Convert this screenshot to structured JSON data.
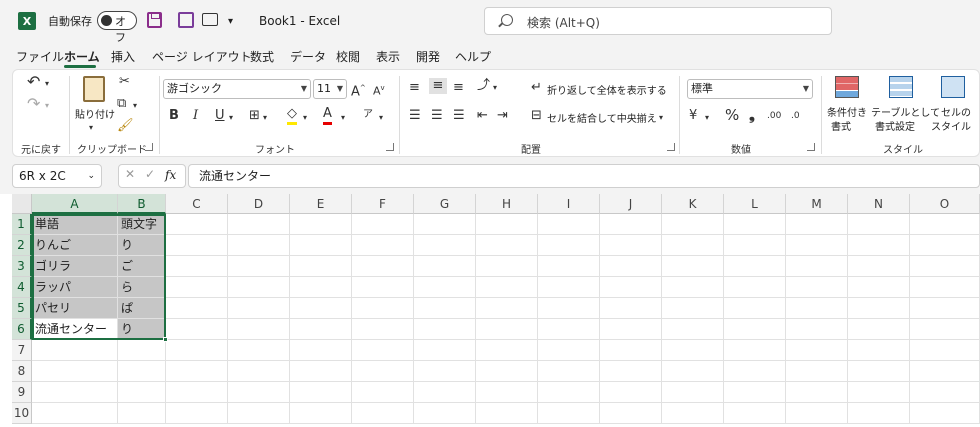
{
  "titlebar": {
    "logo": "X",
    "autosave_label": "自動保存",
    "autosave_state": "オフ",
    "qat_more": "▾",
    "doc_title": "Book1  -  Excel",
    "search_placeholder": "検索 (Alt+Q)"
  },
  "menu": {
    "tabs": [
      "ファイル",
      "ホーム",
      "挿入",
      "ページ レイアウト",
      "数式",
      "データ",
      "校閲",
      "表示",
      "開発",
      "ヘルプ"
    ],
    "active": "ホーム"
  },
  "ribbon": {
    "undo": {
      "label": "元に戻す"
    },
    "clipboard": {
      "paste_label": "貼り付け",
      "group_label": "クリップボード"
    },
    "font": {
      "name": "游ゴシック",
      "size": "11",
      "group_label": "フォント",
      "bold": "B",
      "italic": "I",
      "underline": "U"
    },
    "alignment": {
      "wrap_label": "折り返して全体を表示する",
      "merge_label": "セルを結合して中央揃え",
      "group_label": "配置"
    },
    "number": {
      "format": "標準",
      "percent": "%",
      "comma": "❟",
      "group_label": "数値"
    },
    "styles": {
      "conditional_label_1": "条件付き",
      "conditional_label_2": "書式",
      "table_label_1": "テーブルとして",
      "table_label_2": "書式設定",
      "cell_style_label_1": "セルの",
      "cell_style_label_2": "スタイル",
      "group_label": "スタイル"
    },
    "colors": {
      "brand": "#1d6f42",
      "highlight": "#ffe800",
      "font_color": "#e60000"
    }
  },
  "formula_bar": {
    "name_box": "6R x 2C",
    "fx": "fx",
    "value": "流通センター"
  },
  "sheet": {
    "columns": [
      "A",
      "B",
      "C",
      "D",
      "E",
      "F",
      "G",
      "H",
      "I",
      "J",
      "K",
      "L",
      "M",
      "N",
      "O"
    ],
    "rows": [
      "1",
      "2",
      "3",
      "4",
      "5",
      "6",
      "7",
      "8",
      "9",
      "10"
    ],
    "cells": [
      [
        "単語",
        "頭文字"
      ],
      [
        "りんご",
        "り"
      ],
      [
        "ゴリラ",
        "ご"
      ],
      [
        "ラッパ",
        "ら"
      ],
      [
        "パセリ",
        "ぱ"
      ],
      [
        "流通センター",
        "り"
      ]
    ]
  }
}
